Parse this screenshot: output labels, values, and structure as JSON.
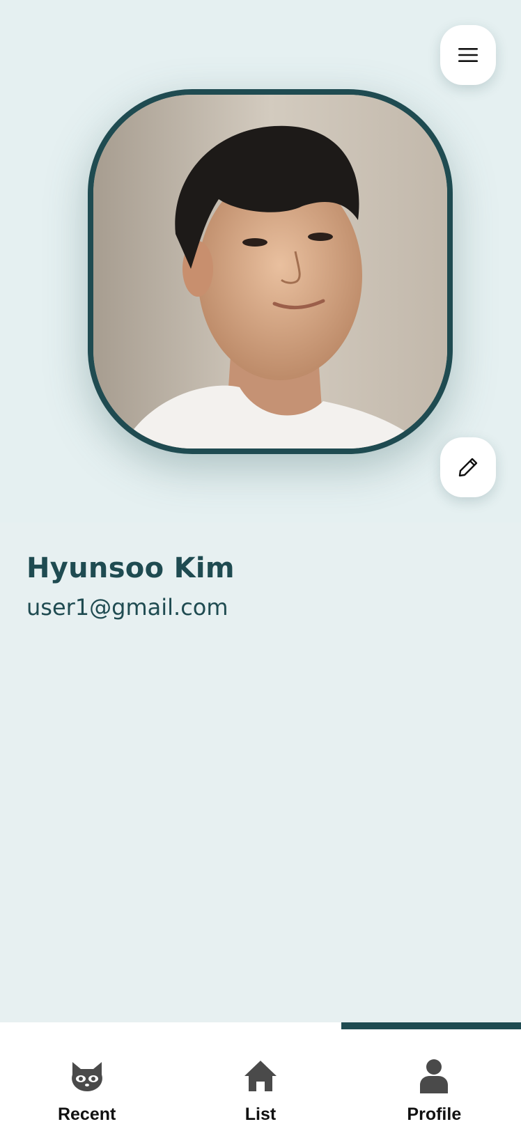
{
  "header": {
    "menu_icon": "hamburger-menu-icon",
    "edit_icon": "pencil-icon"
  },
  "profile": {
    "name": "Hyunsoo Kim",
    "email": "user1@gmail.com"
  },
  "tabs": [
    {
      "label": "Recent",
      "icon": "raccoon-icon",
      "active": false
    },
    {
      "label": "List",
      "icon": "home-icon",
      "active": false
    },
    {
      "label": "Profile",
      "icon": "user-icon",
      "active": true
    }
  ],
  "colors": {
    "accent": "#1f4b51",
    "background": "#e7f0f1",
    "tab_icon": "#4a4a4a"
  }
}
